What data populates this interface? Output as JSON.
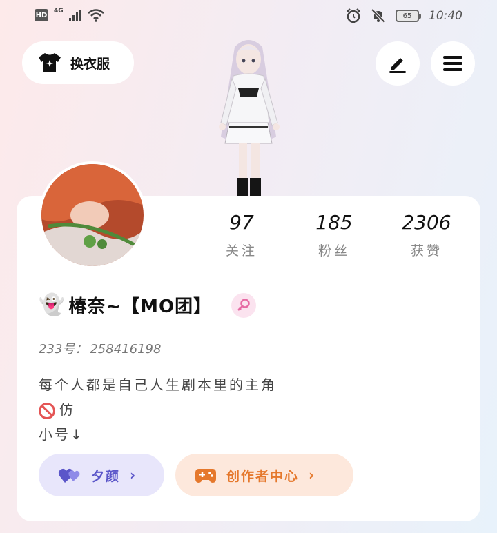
{
  "status_bar": {
    "hd": "HD",
    "network": "4G",
    "battery": "65",
    "time": "10:40"
  },
  "top": {
    "outfit_label": "换衣服",
    "edit_icon": "edit-pen-icon",
    "menu_icon": "menu-icon"
  },
  "stats": [
    {
      "value": "97",
      "label": "关注"
    },
    {
      "value": "185",
      "label": "粉丝"
    },
    {
      "value": "2306",
      "label": "获赞"
    }
  ],
  "profile": {
    "emoji": "👻",
    "name": "椿奈~【MO团】",
    "gender_icon": "female-icon",
    "uid_label": "233号：",
    "uid_value": "258416198",
    "bio": [
      "每个人都是自己人生剧本里的主角",
      "仿",
      "小号↓"
    ]
  },
  "buttons": {
    "group_label": "夕颜",
    "creator_label": "创作者中心"
  },
  "colors": {
    "group_accent": "#5b56c9",
    "creator_accent": "#e5782c",
    "gender_pink": "#e66aa3"
  }
}
